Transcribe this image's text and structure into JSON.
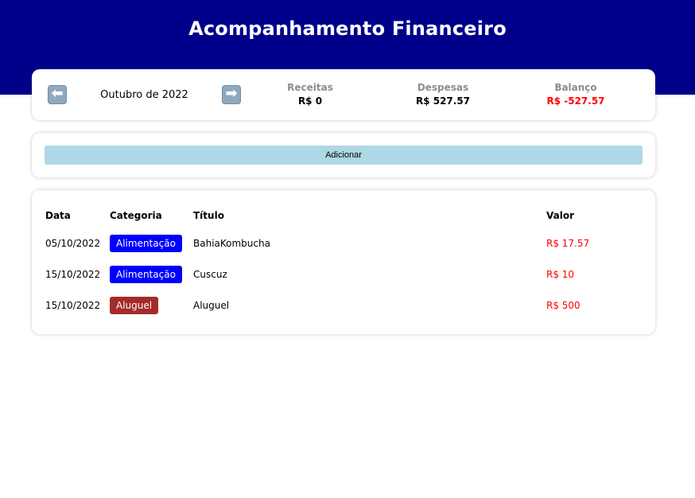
{
  "header": {
    "title": "Acompanhamento Financeiro"
  },
  "info": {
    "prev_icon": "left-arrow-icon",
    "next_icon": "right-arrow-icon",
    "prev_glyph": "⬅",
    "next_glyph": "➡",
    "month": "Outubro de 2022",
    "income": {
      "label": "Receitas",
      "value": "R$ 0"
    },
    "expense": {
      "label": "Despesas",
      "value": "R$ 527.57"
    },
    "balance": {
      "label": "Balanço",
      "value": "R$ -527.57"
    }
  },
  "actions": {
    "add_label": "Adicionar"
  },
  "table": {
    "headers": {
      "date": "Data",
      "category": "Categoria",
      "title": "Título",
      "value": "Valor"
    },
    "rows": [
      {
        "date": "05/10/2022",
        "category": "Alimentação",
        "title": "BahiaKombucha",
        "value": "R$ 17.57"
      },
      {
        "date": "15/10/2022",
        "category": "Alimentação",
        "title": "Cuscuz",
        "value": "R$ 10"
      },
      {
        "date": "15/10/2022",
        "category": "Aluguel",
        "title": "Aluguel",
        "value": "R$ 500"
      }
    ]
  },
  "colors": {
    "header_bg": "#00008b",
    "add_button_bg": "#add8e6",
    "category_alimentacao": "#0000ff",
    "category_aluguel": "#a52a2a",
    "negative": "#ff0000"
  }
}
